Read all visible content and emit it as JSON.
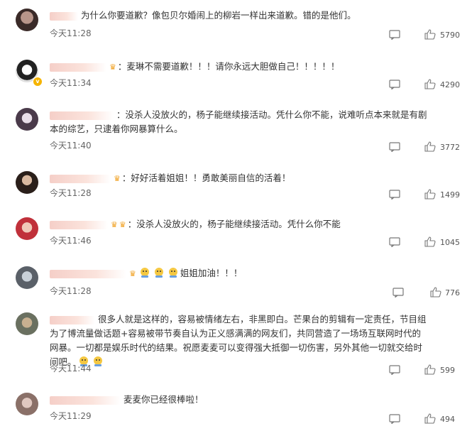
{
  "comments": [
    {
      "text": "为什么你要道歉？像包贝尔婚闹上的柳岩一样出来道歉。错的是他们。",
      "time": "今天11:28",
      "likes": "5790"
    },
    {
      "text": "：麦琳不需要道歉！！！请你永远大胆做自己！！！！！",
      "time": "今天11:34",
      "likes": "4290"
    },
    {
      "text": "：没杀人没放火的，杨子能继续接活动。凭什么你不能，说难听点本来就是有剧本的综艺，只逮着你网暴算什么。",
      "time": "今天11:40",
      "likes": "3772"
    },
    {
      "text": "：好好活着姐姐！！勇敢美丽自信的活着！",
      "time": "今天11:28",
      "likes": "1499"
    },
    {
      "text": "：没杀人没放火的，杨子能继续接活动。凭什么你不能",
      "time": "今天11:46",
      "likes": "1045"
    },
    {
      "text": "姐姐加油！！！",
      "time": "今天11:28",
      "likes": "776"
    },
    {
      "text": "很多人就是这样的，容易被情绪左右，非黑即白。芒果台的剪辑有一定责任，节目组为了博流量做话题+容易被带节奏自认为正义感满满的网友们，共同营造了一场场互联网时代的网暴。一切都是娱乐时代的结果。祝愿麦麦可以变得强大抵御一切伤害，另外其他一切就交给时间吧。",
      "time": "今天11:44",
      "likes": "599"
    },
    {
      "text": "麦麦你已经很棒啦！",
      "time": "今天11:29",
      "likes": "494"
    }
  ],
  "icons": {
    "reply": "reply-icon",
    "like": "thumbs-up-icon",
    "crown": "crown-icon",
    "emoji": "doge-emoji-icon"
  },
  "colors": {
    "nickname": "#f5cfc8",
    "text": "#333333",
    "meta": "#666666"
  }
}
